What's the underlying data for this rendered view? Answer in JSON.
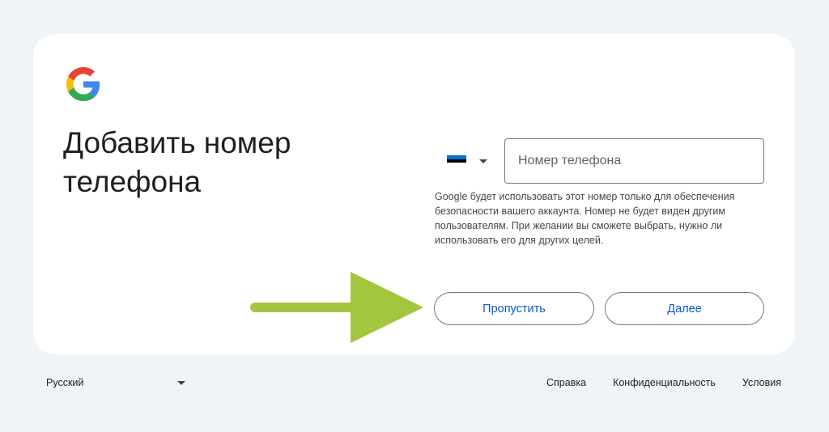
{
  "page": {
    "title": "Добавить номер телефона"
  },
  "phone": {
    "country_flag": "estonia-flag",
    "placeholder": "Номер телефона",
    "value": ""
  },
  "hint": "Google будет использовать этот номер только для обеспечения безопасности вашего аккаунта. Номер не будет виден другим пользователям. При желании вы сможете выбрать, нужно ли использовать его для других целей.",
  "buttons": {
    "skip_label": "Пропустить",
    "next_label": "Далее"
  },
  "footer": {
    "language": "Русский",
    "links": [
      "Справка",
      "Конфиденциальность",
      "Условия"
    ]
  },
  "colors": {
    "background": "#f0f4f9",
    "accent": "#0b57d0",
    "arrow": "#a4c63f",
    "flag": [
      "#0072ce",
      "#000000",
      "#ffffff"
    ]
  }
}
